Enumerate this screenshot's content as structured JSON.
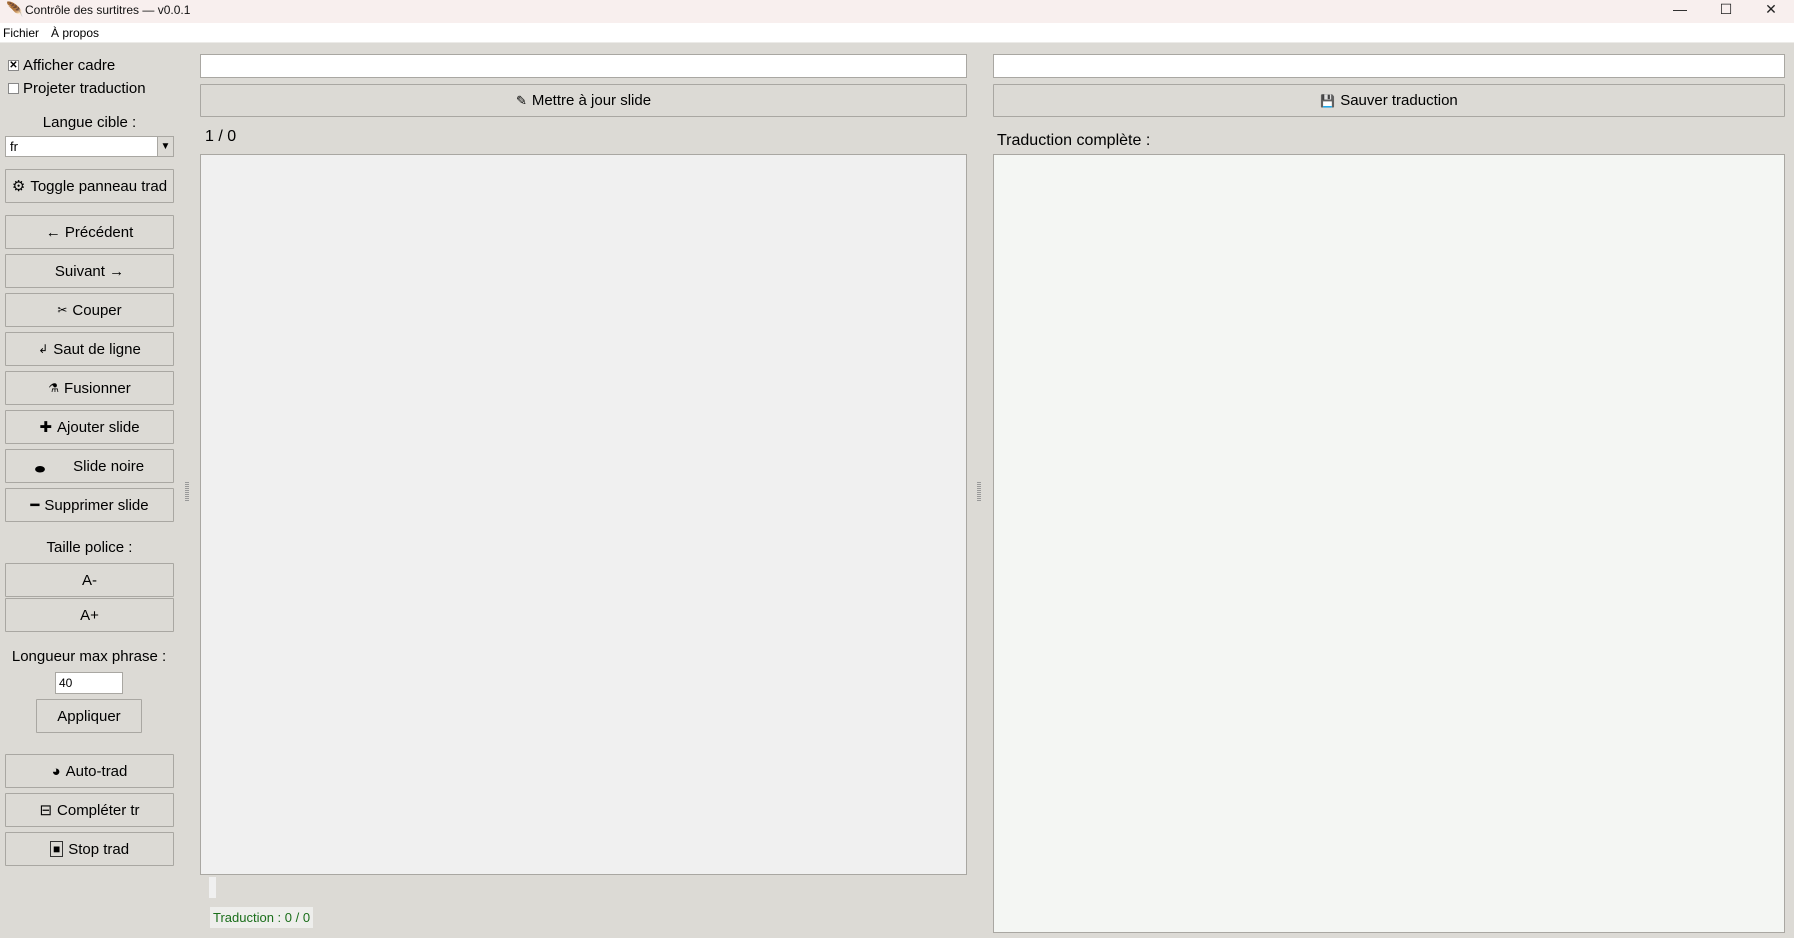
{
  "window": {
    "title": "Contrôle des surtitres — v0.0.1",
    "minimize": "—",
    "maximize": "☐",
    "close": "✕"
  },
  "menu": [
    "Fichier",
    "À propos"
  ],
  "sidebar": {
    "show_frame": {
      "label": "Afficher cadre",
      "checked": true,
      "mark": "✕"
    },
    "project_translation": {
      "label": "Projeter traduction",
      "checked": false
    },
    "target_language_label": "Langue cible :",
    "target_language_value": "fr",
    "toggle_panel": {
      "icon": "⚙",
      "label": "Toggle panneau trad"
    },
    "buttons": [
      {
        "icon": "",
        "label": "← Précédent"
      },
      {
        "icon": "",
        "label": "Suivant →"
      },
      {
        "icon": "✂",
        "label": "Couper"
      },
      {
        "icon": "↲",
        "label": "Saut de ligne"
      },
      {
        "icon": "⚗",
        "label": "Fusionner"
      },
      {
        "icon": "✚",
        "label": "Ajouter slide"
      },
      {
        "icon": "⬬",
        "label": "Slide noire"
      },
      {
        "icon": "━",
        "label": "Supprimer slide"
      }
    ],
    "font_size_label": "Taille police :",
    "font_decrease": "A-",
    "font_increase": "A+",
    "max_length_label": "Longueur max phrase :",
    "max_length_value": "40",
    "apply": "Appliquer",
    "auto_trad": {
      "icon": "◕",
      "label": "Auto-trad"
    },
    "complete_tr": {
      "icon": "⊟",
      "label": "Compléter tr"
    },
    "stop_trad": {
      "icon": "■",
      "label": "Stop trad"
    }
  },
  "center": {
    "slide_input": "",
    "update_button": {
      "icon": "✎",
      "label": "Mettre à jour slide"
    },
    "counter": "1 / 0",
    "status": "Traduction : 0 / 0",
    "status_color": "#1a6e1a"
  },
  "right": {
    "translation_input": "",
    "save_button": {
      "icon": "💾",
      "label": "Sauver traduction"
    },
    "full_translation_label": "Traduction complète :"
  }
}
